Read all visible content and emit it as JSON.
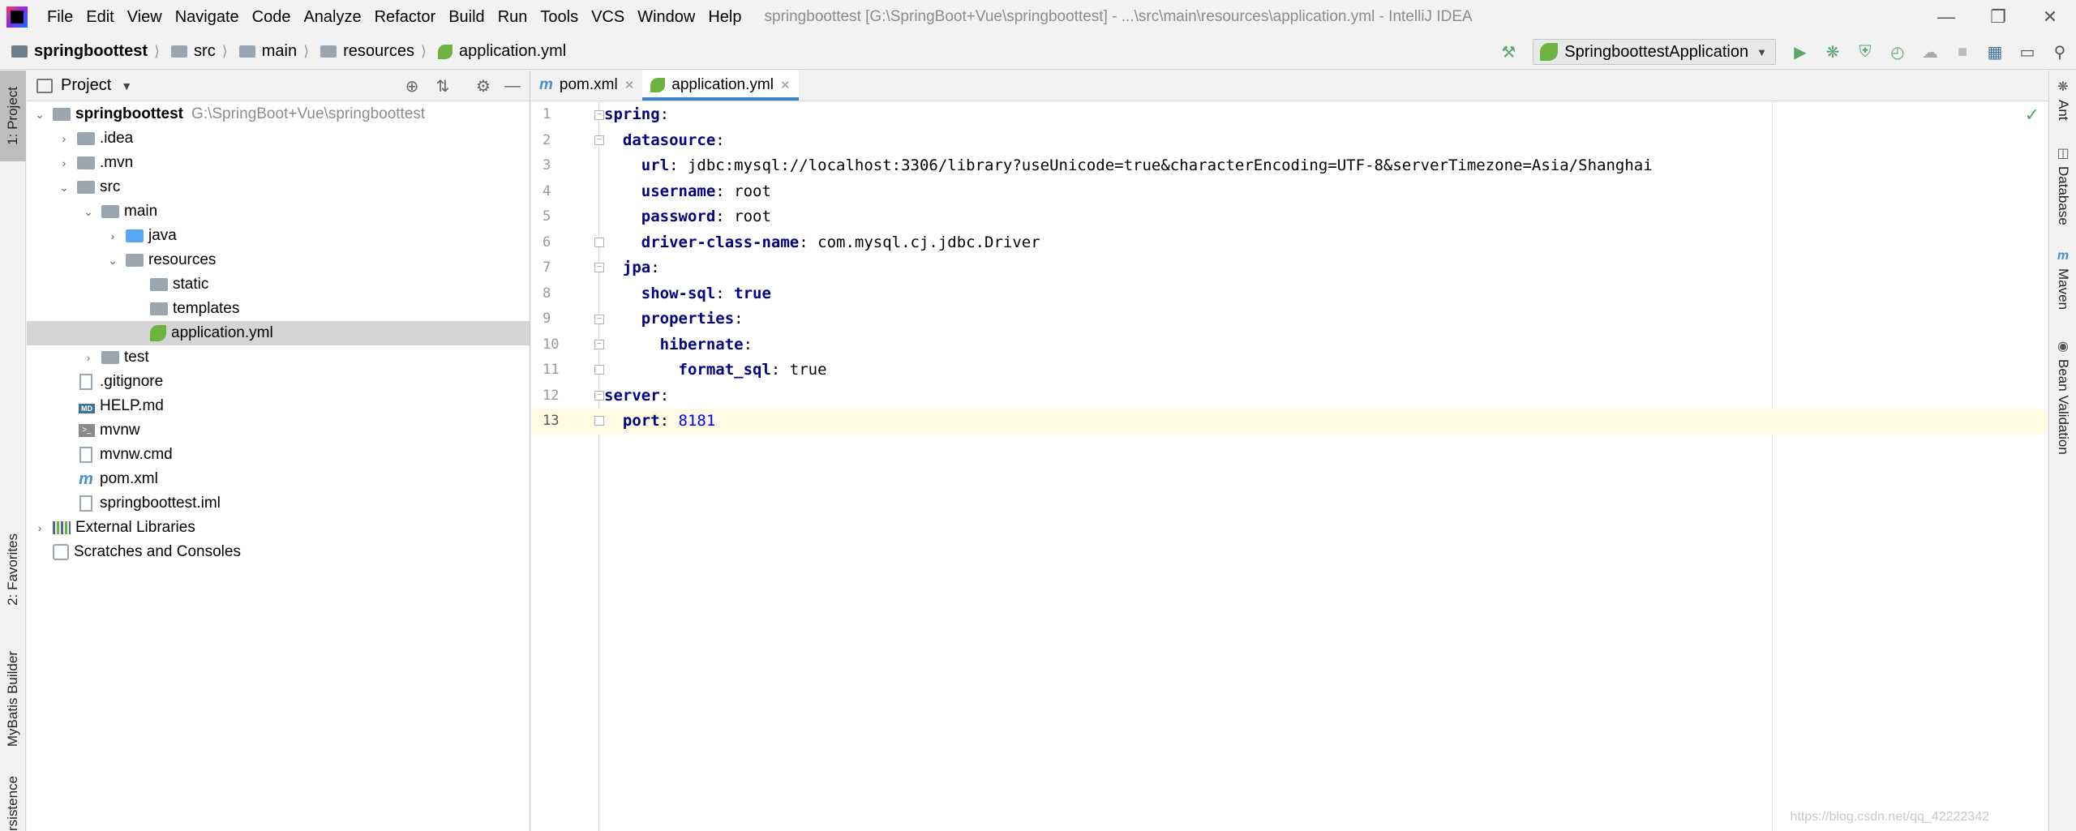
{
  "menubar": {
    "items": [
      "File",
      "Edit",
      "View",
      "Navigate",
      "Code",
      "Analyze",
      "Refactor",
      "Build",
      "Run",
      "Tools",
      "VCS",
      "Window",
      "Help"
    ],
    "window_title": "springboottest [G:\\SpringBoot+Vue\\springboottest] - ...\\src\\main\\resources\\application.yml - IntelliJ IDEA"
  },
  "breadcrumb": [
    "springboottest",
    "src",
    "main",
    "resources",
    "application.yml"
  ],
  "toolbar": {
    "run_config": "SpringboottestApplication"
  },
  "left_strip": {
    "project_tab": "1: Project",
    "favorites_tab": "2: Favorites",
    "mybatis_tab": "MyBatis Builder",
    "persistence_tab": "Persistence"
  },
  "project_panel": {
    "title": "Project",
    "tree": [
      {
        "name": "springboottest",
        "path": "G:\\SpringBoot+Vue\\springboottest"
      },
      {
        "name": ".idea"
      },
      {
        "name": ".mvn"
      },
      {
        "name": "src"
      },
      {
        "name": "main"
      },
      {
        "name": "java"
      },
      {
        "name": "resources"
      },
      {
        "name": "static"
      },
      {
        "name": "templates"
      },
      {
        "name": "application.yml"
      },
      {
        "name": "test"
      },
      {
        "name": ".gitignore"
      },
      {
        "name": "HELP.md"
      },
      {
        "name": "mvnw"
      },
      {
        "name": "mvnw.cmd"
      },
      {
        "name": "pom.xml"
      },
      {
        "name": "springboottest.iml"
      },
      {
        "name": "External Libraries"
      },
      {
        "name": "Scratches and Consoles"
      }
    ]
  },
  "editor": {
    "tabs": [
      "pom.xml",
      "application.yml"
    ],
    "active_tab": "application.yml",
    "line_numbers": [
      "1",
      "2",
      "3",
      "4",
      "5",
      "6",
      "7",
      "8",
      "9",
      "10",
      "11",
      "12",
      "13"
    ],
    "code": [
      {
        "key": "spring",
        "value": ""
      },
      {
        "key": "datasource",
        "value": ""
      },
      {
        "key": "url",
        "value": "jdbc:mysql://localhost:3306/library?useUnicode=true&characterEncoding=UTF-8&serverTimezone=Asia/Shanghai"
      },
      {
        "key": "username",
        "value": "root"
      },
      {
        "key": "password",
        "value": "root"
      },
      {
        "key": "driver-class-name",
        "value": "com.mysql.cj.jdbc.Driver"
      },
      {
        "key": "jpa",
        "value": ""
      },
      {
        "key": "show-sql",
        "value": "true"
      },
      {
        "key": "properties",
        "value": ""
      },
      {
        "key": "hibernate",
        "value": ""
      },
      {
        "key": "format_sql",
        "value": "true"
      },
      {
        "key": "server",
        "value": ""
      },
      {
        "key": "port",
        "value": "8181"
      }
    ]
  },
  "right_strip": {
    "ant": "Ant",
    "database": "Database",
    "maven": "Maven",
    "bean_validation": "Bean Validation"
  },
  "watermark": "https://blog.csdn.net/qq_42222342",
  "colors": {
    "key": "#000080",
    "number": "#0000ff",
    "selection": "#d5d5d5",
    "current_line": "#fffae3",
    "tab_underline": "#4083c9"
  }
}
